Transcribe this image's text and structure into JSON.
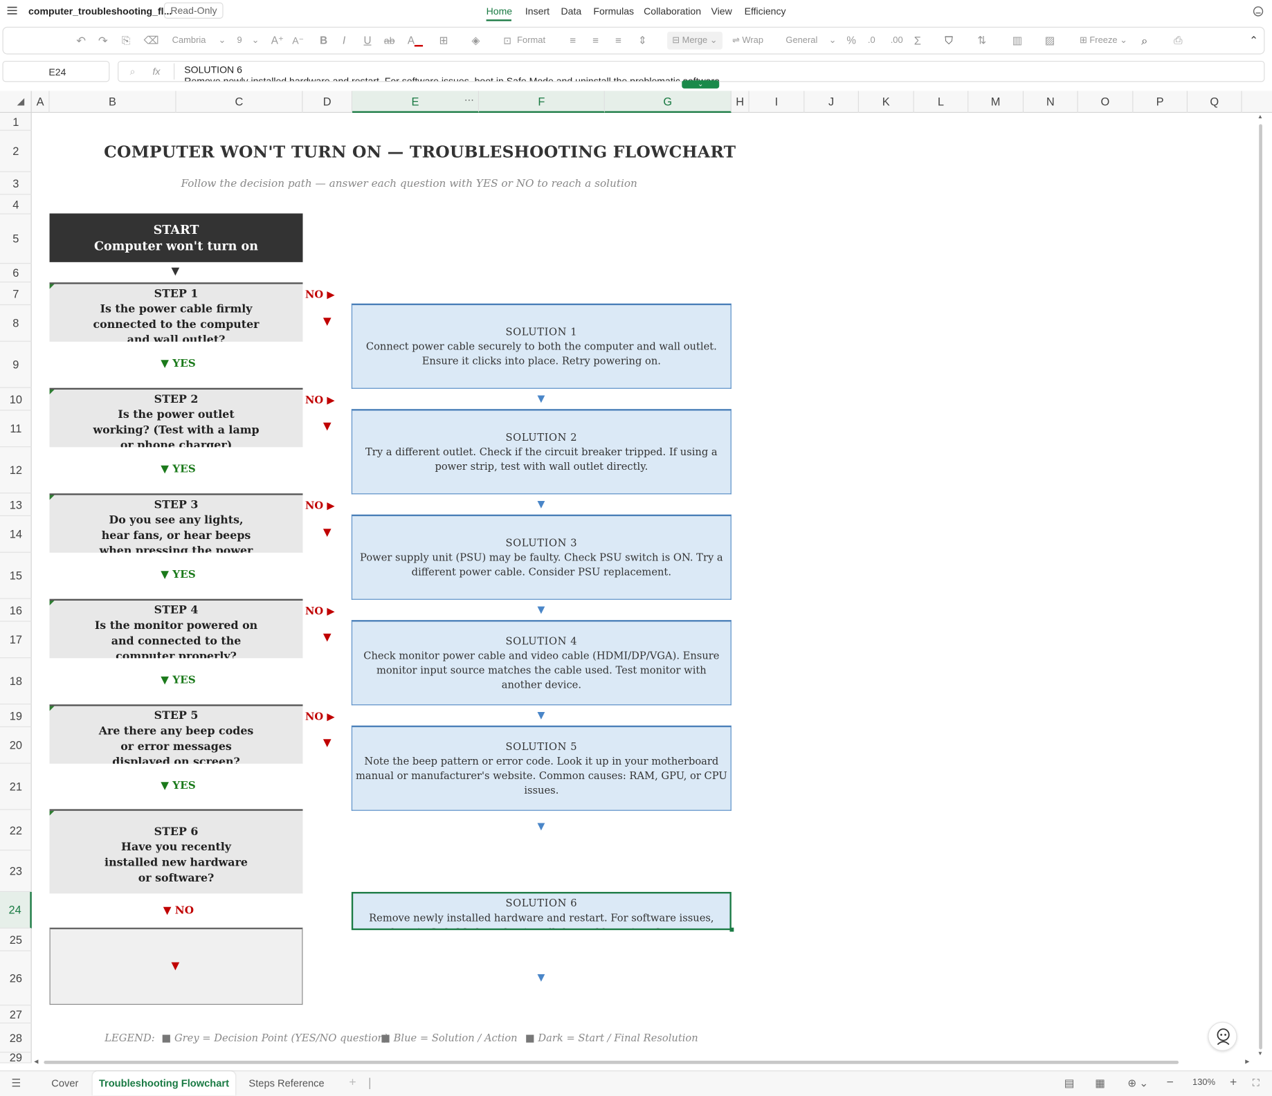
{
  "menubar": {
    "filename": "computer_troubleshooting_fl...",
    "readonly": "Read-Only",
    "menus": [
      "Home",
      "Insert",
      "Data",
      "Formulas",
      "Collaboration",
      "View",
      "Efficiency"
    ]
  },
  "toolbar": {
    "font": "Cambria",
    "size": "9",
    "format": "Format",
    "merge": "Merge",
    "wrap": "Wrap",
    "number_format": "General",
    "percent": "%",
    "freeze": "Freeze"
  },
  "formula": {
    "cell_ref": "E24",
    "fx": "fx",
    "line1": "SOLUTION 6",
    "line2": "Remove newly installed hardware and restart. For software issues, boot in Safe Mode and uninstall the problematic software."
  },
  "columns": [
    "A",
    "B",
    "C",
    "D",
    "E",
    "F",
    "G",
    "H",
    "I",
    "J",
    "K",
    "L",
    "M",
    "N",
    "O",
    "P",
    "Q"
  ],
  "rows": [
    "1",
    "2",
    "3",
    "4",
    "5",
    "6",
    "7",
    "8",
    "9",
    "10",
    "11",
    "12",
    "13",
    "14",
    "15",
    "16",
    "17",
    "18",
    "19",
    "20",
    "21",
    "22",
    "23",
    "24",
    "25",
    "26",
    "27",
    "28",
    "29"
  ],
  "sheet": {
    "title": "COMPUTER WON'T TURN ON — TROUBLESHOOTING FLOWCHART",
    "subtitle": "Follow the decision path  — answer each question with YES or NO to reach a solution",
    "start_line1": "START",
    "start_line2": "Computer won't turn on",
    "down_arrow": "▼",
    "right_arrow": "▶",
    "no": "NO",
    "yes": "YES",
    "steps": [
      {
        "label": "STEP 1",
        "text": "Is the power cable firmly connected to the computer and wall outlet?"
      },
      {
        "label": "STEP 2",
        "text": "Is the power outlet working? (Test with a lamp or phone charger)"
      },
      {
        "label": "STEP 3",
        "text": "Do you see any lights, hear fans, or hear beeps when pressing the power"
      },
      {
        "label": "STEP 4",
        "text": "Is the monitor powered on and connected to the computer properly?"
      },
      {
        "label": "STEP 5",
        "text": "Are there any beep codes or error messages displayed on screen?"
      },
      {
        "label": "STEP 6",
        "text": "Have you recently installed new hardware or software?"
      }
    ],
    "solutions": [
      {
        "label": "SOLUTION 1",
        "text": "Connect power cable securely to both the computer and wall outlet. Ensure it clicks into place. Retry powering on."
      },
      {
        "label": "SOLUTION 2",
        "text": "Try a different outlet. Check if the circuit breaker tripped. If using a power strip, test with wall outlet directly."
      },
      {
        "label": "SOLUTION 3",
        "text": "Power supply unit (PSU) may be faulty. Check PSU switch is ON. Try a different power cable. Consider PSU replacement."
      },
      {
        "label": "SOLUTION 4",
        "text": "Check monitor power cable and video cable (HDMI/DP/VGA). Ensure monitor input source matches the cable used. Test monitor with another device."
      },
      {
        "label": "SOLUTION 5",
        "text": "Note the beep pattern or error code. Look it up in your motherboard manual or manufacturer's website. Common causes: RAM, GPU, or CPU issues."
      },
      {
        "label": "SOLUTION 6",
        "text": "Remove newly installed hardware and restart. For software issues, boot in Safe Mode and uninstall the problematic software."
      }
    ],
    "legend": {
      "label": "LEGEND:",
      "grey": "Grey = Decision Point (YES/NO question)",
      "blue": "Blue = Solution / Action",
      "dark": "Dark = Start / Final Resolution"
    }
  },
  "tabs": [
    "Cover",
    "Troubleshooting Flowchart",
    "Steps Reference"
  ],
  "status": {
    "zoom": "130%"
  }
}
